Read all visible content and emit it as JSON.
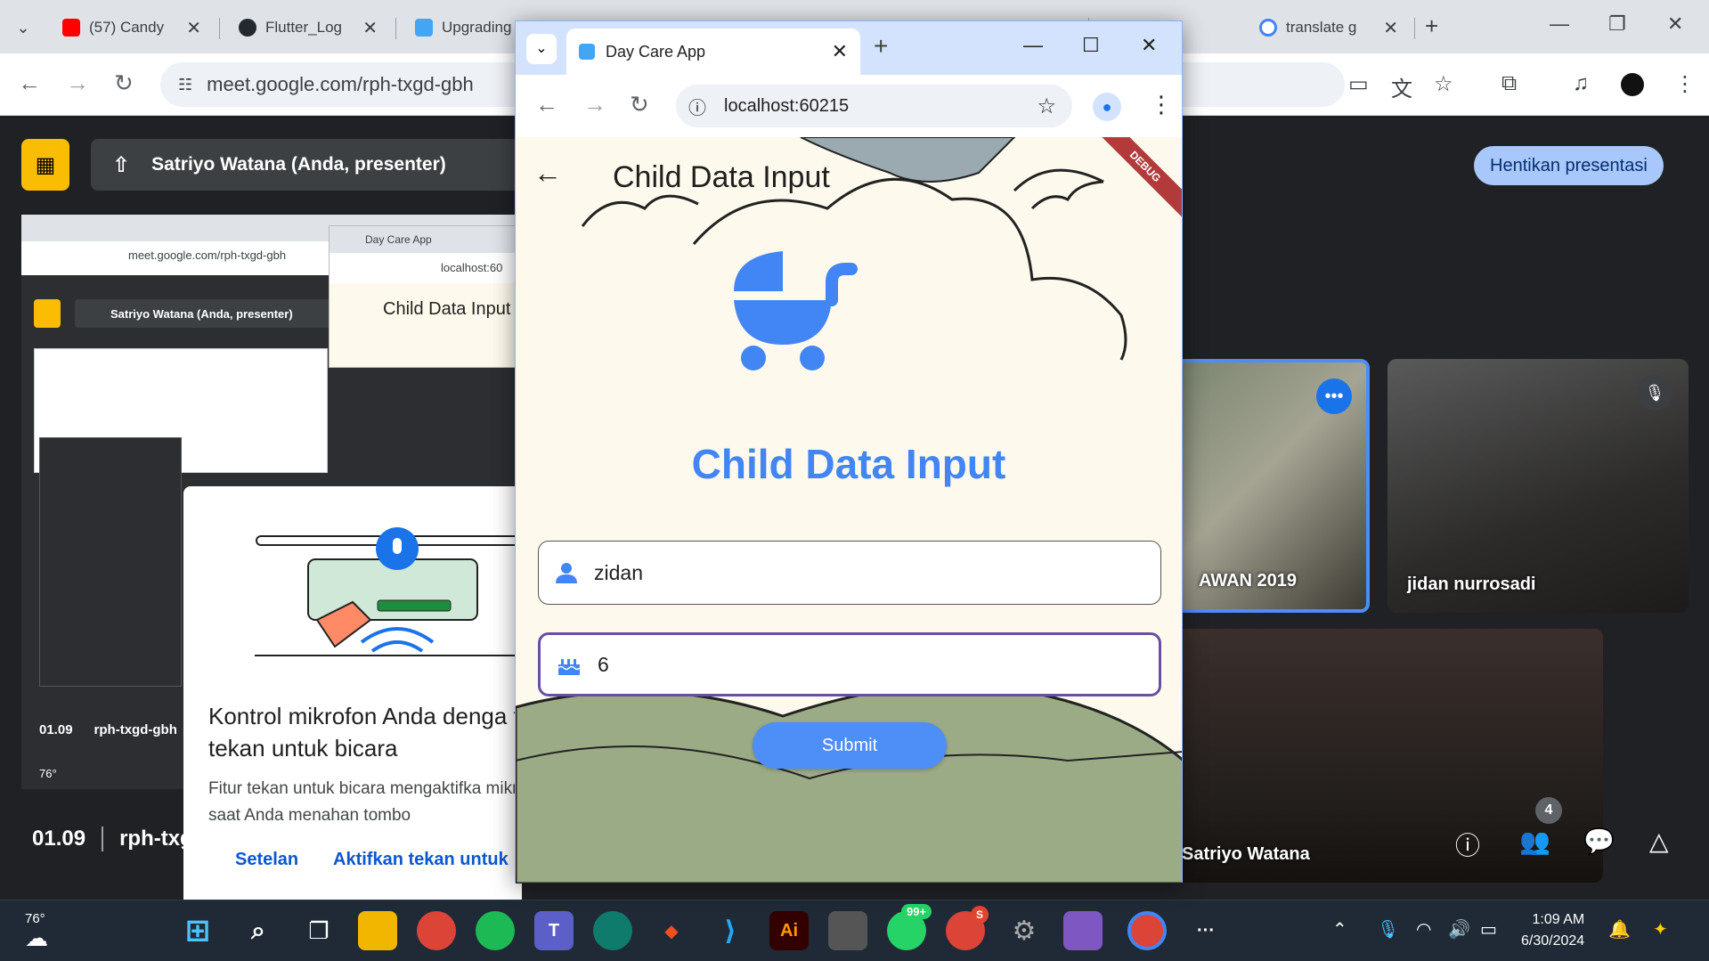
{
  "browser": {
    "tabs": [
      {
        "label": "(57) Candy",
        "favicon_color": "#ff0000"
      },
      {
        "label": "Flutter_Log",
        "favicon_color": "#24292f"
      },
      {
        "label": "Upgrading",
        "favicon_color": "#42a5f5"
      },
      {
        "label": "translate g",
        "favicon_color": "#4285f4"
      }
    ],
    "url": "meet.google.com/rph-txgd-gbh"
  },
  "meet": {
    "presenter_label": "Satriyo Watana (Anda, presenter)",
    "stop_button": "Hentikan presentasi",
    "meeting_time": "01.09",
    "meeting_code": "rph-txgd-gbh",
    "participant_count": "4",
    "participants": [
      {
        "name": "AWAN 2019"
      },
      {
        "name": "jidan nurrosadi"
      },
      {
        "name": "Satriyo Watana"
      }
    ]
  },
  "shared_screen": {
    "mini_url": "meet.google.com/rph-txgd-gbh",
    "mini_presenter": "Satriyo Watana (Anda, presenter)",
    "mini_app_tab": "Day Care App",
    "mini_local_url": "localhost:60",
    "mini_app_title": "Child Data Input",
    "footer_time": "01.09",
    "footer_code": "rph-txgd-gbh",
    "weather_temp": "76°"
  },
  "mic_dialog": {
    "title": "Kontrol mikrofon Anda denga fitur tekan untuk bicara",
    "body": "Fitur tekan untuk bicara mengaktifka mikrofon saat Anda menahan tombo",
    "settings_button": "Setelan",
    "enable_button": "Aktifkan tekan untuk"
  },
  "popup": {
    "tab_title": "Day Care App",
    "url": "localhost:60215"
  },
  "app": {
    "appbar_title": "Child Data Input",
    "heading": "Child Data Input",
    "debug_banner": "DEBUG",
    "name_value": "zidan",
    "age_value": "6",
    "submit_label": "Submit",
    "accent": "#4285f4",
    "background": "#fdf9ec"
  },
  "taskbar": {
    "weather_temp": "76°",
    "whatsapp_badge": "99+",
    "chrome_badge": "S",
    "time": "1:09 AM",
    "date": "6/30/2024"
  }
}
